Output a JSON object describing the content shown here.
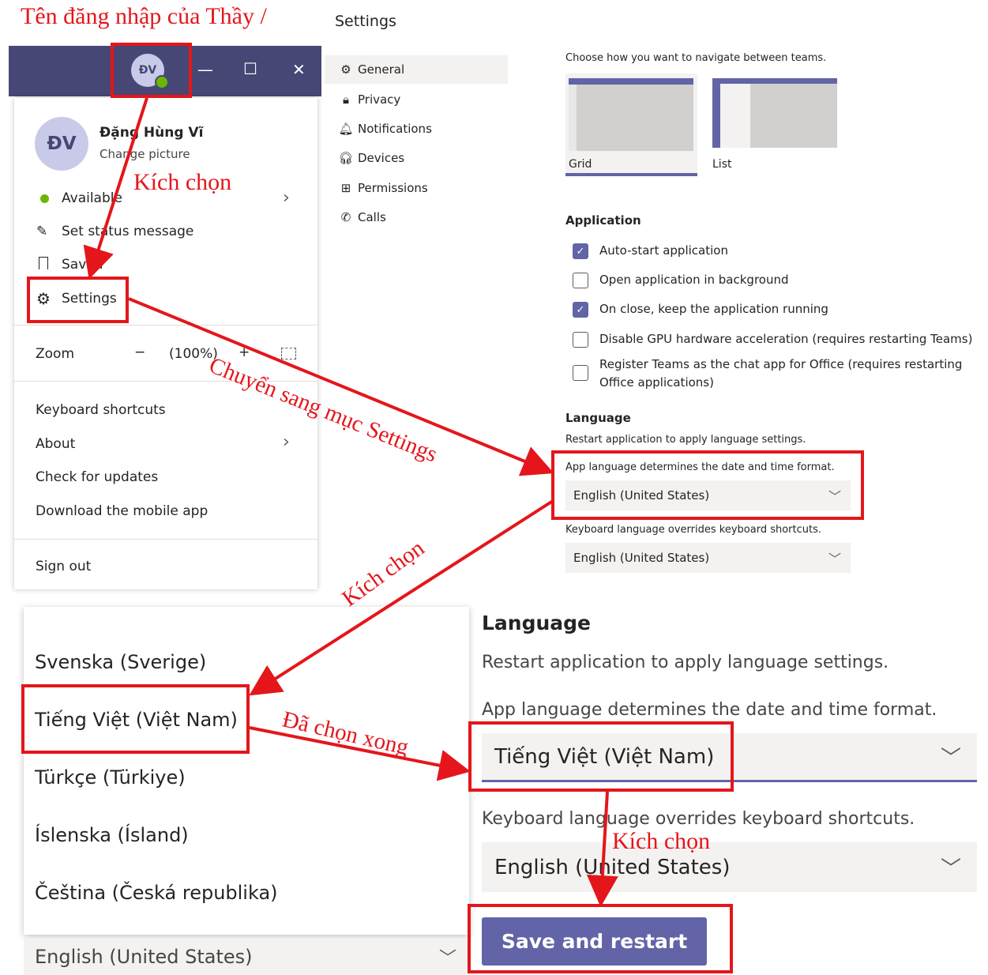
{
  "annotations": {
    "account_name": "Tên đăng nhập của Thầy /",
    "click1": "Kích chọn",
    "go_settings": "Chuyển sang mục Settings",
    "click2": "Kích chọn",
    "selected_done": "Đã chọn xong",
    "click3": "Kích chọn"
  },
  "titlebar": {
    "initials": "ĐV",
    "minimize": "—",
    "maximize": "☐",
    "close": "✕"
  },
  "profile": {
    "initials": "ĐV",
    "name": "Đặng Hùng Vĩ",
    "change_picture": "Change picture",
    "status": "Available",
    "set_status": "Set status message",
    "saved": "Saved",
    "settings": "Settings",
    "zoom_label": "Zoom",
    "zoom_minus": "−",
    "zoom_value": "(100%)",
    "zoom_plus": "+",
    "keyboard_shortcuts": "Keyboard shortcuts",
    "about": "About",
    "check_updates": "Check for updates",
    "download_mobile": "Download the mobile app",
    "sign_out": "Sign out"
  },
  "settings": {
    "title": "Settings",
    "nav": [
      {
        "label": "General"
      },
      {
        "label": "Privacy"
      },
      {
        "label": "Notifications"
      },
      {
        "label": "Devices"
      },
      {
        "label": "Permissions"
      },
      {
        "label": "Calls"
      }
    ],
    "layout_desc": "Choose how you want to navigate between teams.",
    "layout_grid": "Grid",
    "layout_list": "List",
    "application_heading": "Application",
    "checkboxes": [
      {
        "label": "Auto-start application",
        "checked": true
      },
      {
        "label": "Open application in background",
        "checked": false
      },
      {
        "label": "On close, keep the application running",
        "checked": true
      },
      {
        "label": "Disable GPU hardware acceleration (requires restarting Teams)",
        "checked": false
      },
      {
        "label": "Register Teams as the chat app for Office (requires restarting Office applications)",
        "checked": false
      }
    ],
    "language_heading": "Language",
    "language_restart": "Restart application to apply language settings.",
    "app_language_desc": "App language determines the date and time format.",
    "app_language_value": "English (United States)",
    "keyboard_language_desc": "Keyboard language overrides keyboard shortcuts.",
    "keyboard_language_value": "English (United States)"
  },
  "language_list": {
    "items": [
      "Svenska (Sverige)",
      "Tiếng Việt (Việt Nam)",
      "Türkçe (Türkiye)",
      "Íslenska (Ísland)",
      "Čeština (Česká republika)"
    ],
    "current_value": "English (United States)"
  },
  "language_zoom": {
    "heading": "Language",
    "restart": "Restart application to apply language settings.",
    "app_desc": "App language determines the date and time format.",
    "app_value": "Tiếng Việt (Việt Nam)",
    "keyboard_desc": "Keyboard language overrides keyboard shortcuts.",
    "keyboard_value": "English (United States)",
    "save_button": "Save and restart"
  },
  "colors": {
    "annotation_red": "#e4161b",
    "teams_purple": "#6264a7",
    "titlebar": "#464775"
  }
}
